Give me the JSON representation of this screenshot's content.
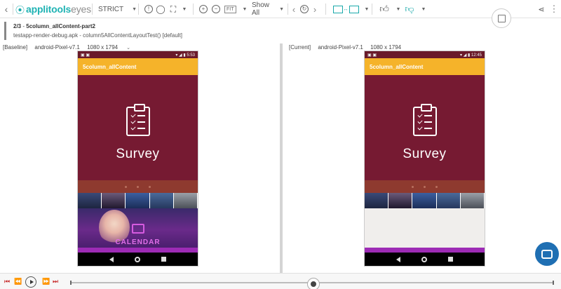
{
  "toolbar": {
    "logo_brand": "applitools",
    "logo_product": "eyes",
    "match_level": "STRICT",
    "fit_label": "FIT",
    "show_label": "Show All"
  },
  "step": {
    "counter": "2/3",
    "separator": "-",
    "name": "5column_allContent-part2",
    "detail": "testapp-render-debug.apk - column5AllContentLayoutTest() [default]"
  },
  "baseline": {
    "tag": "[Baseline]",
    "device": "android-Pixel-v7.1",
    "resolution": "1080 x 1794",
    "status_time": "5:53",
    "app_title": "5column_allContent",
    "survey_text": "Survey",
    "calendar_text": "CALENDAR"
  },
  "current": {
    "tag": "[Current]",
    "device": "android-Pixel-v7.1",
    "resolution": "1080 x 1794",
    "status_time": "12:45",
    "app_title": "5column_allContent",
    "survey_text": "Survey"
  },
  "colors": {
    "brand_teal": "#1fb3b4",
    "app_bar": "#f5b32a",
    "hero": "#761a32",
    "chat": "#1f6fb3"
  },
  "icons": [
    "back-chevron-icon",
    "info-icon",
    "comment-icon",
    "crop-icon",
    "zoom-in-icon",
    "zoom-out-icon",
    "prev-icon",
    "refresh-icon",
    "next-icon",
    "compare-icon",
    "thumbs-up-icon",
    "thumbs-down-icon",
    "save-icon",
    "share-icon",
    "chat-icon",
    "play-icon"
  ]
}
